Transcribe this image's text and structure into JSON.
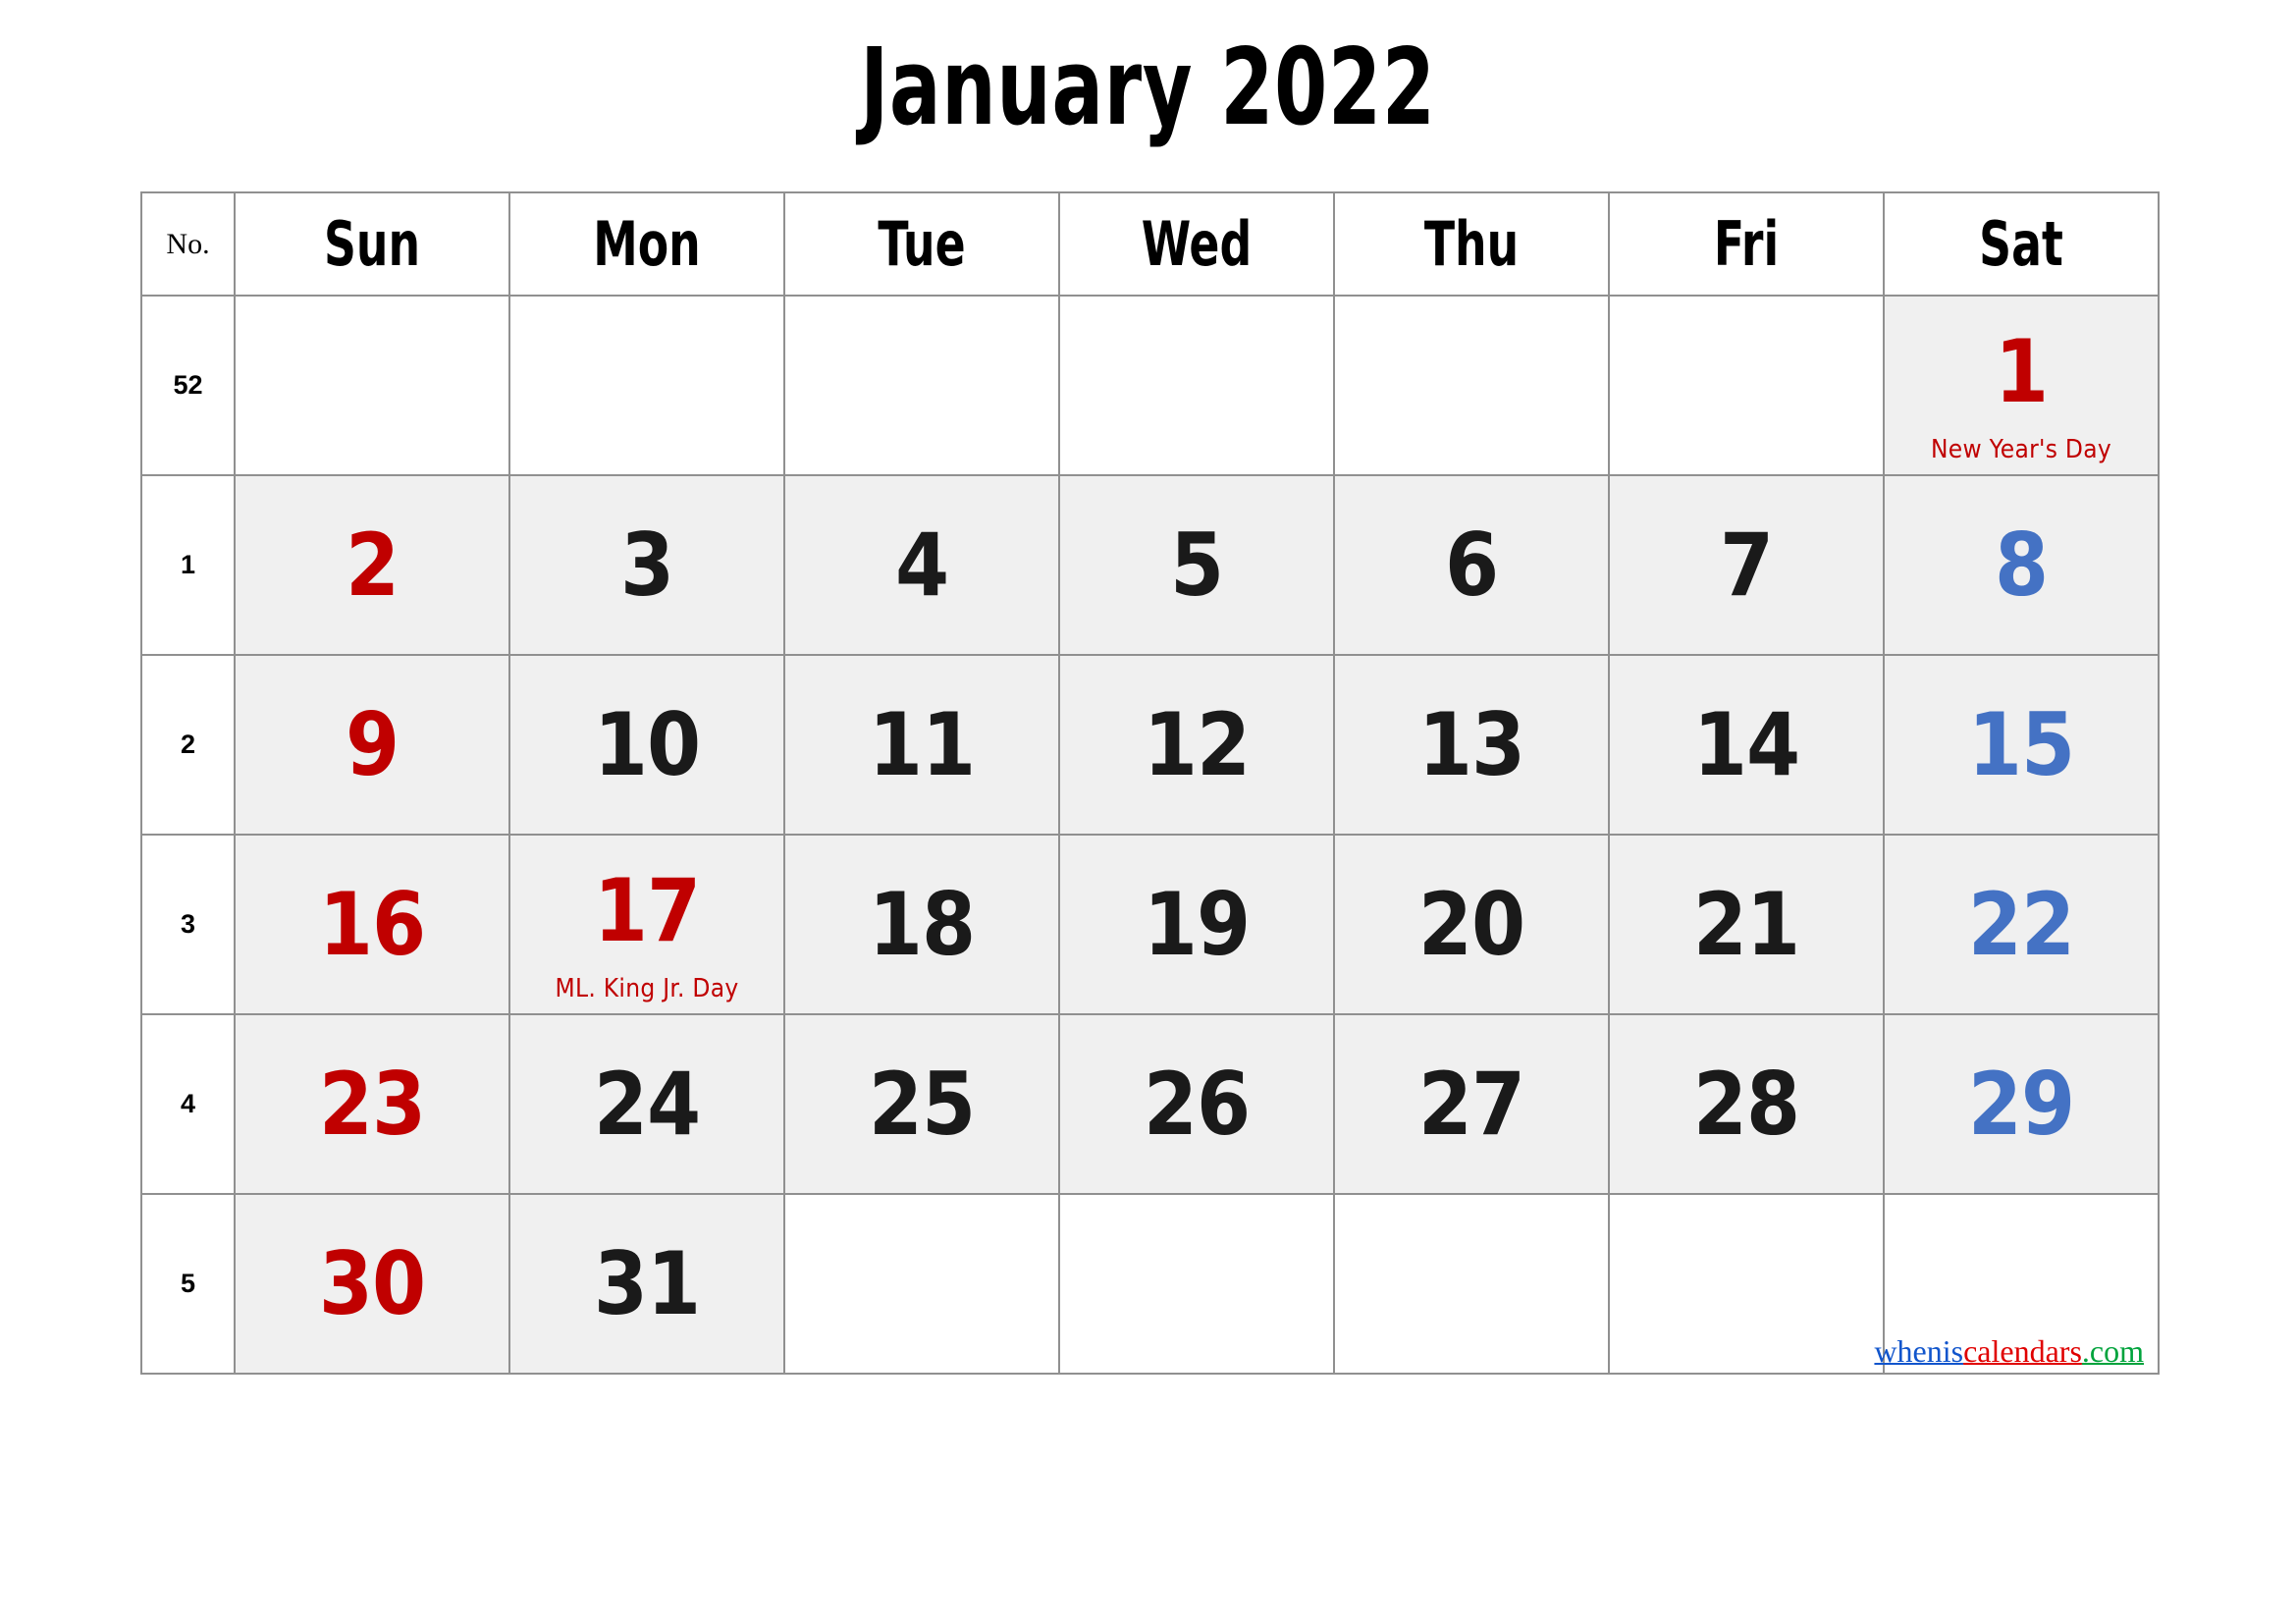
{
  "title": "January 2022",
  "colors": {
    "sunday": "#c00000",
    "saturday": "#4472c4",
    "weekday": "#1a1a1a",
    "holiday": "#c00000",
    "cell_fill": "#f0f0f0",
    "border": "#909090"
  },
  "header": {
    "week_no_label": "No.",
    "days": [
      "Sun",
      "Mon",
      "Tue",
      "Wed",
      "Thu",
      "Fri",
      "Sat"
    ]
  },
  "weeks": [
    {
      "no": "52",
      "days": [
        {
          "num": "",
          "kind": "empty",
          "filled": false,
          "holiday": ""
        },
        {
          "num": "",
          "kind": "empty",
          "filled": false,
          "holiday": ""
        },
        {
          "num": "",
          "kind": "empty",
          "filled": false,
          "holiday": ""
        },
        {
          "num": "",
          "kind": "empty",
          "filled": false,
          "holiday": ""
        },
        {
          "num": "",
          "kind": "empty",
          "filled": false,
          "holiday": ""
        },
        {
          "num": "",
          "kind": "empty",
          "filled": false,
          "holiday": ""
        },
        {
          "num": "1",
          "kind": "holiday",
          "filled": true,
          "holiday": "New Year's Day"
        }
      ]
    },
    {
      "no": "1",
      "days": [
        {
          "num": "2",
          "kind": "sun",
          "filled": true,
          "holiday": ""
        },
        {
          "num": "3",
          "kind": "weekday",
          "filled": true,
          "holiday": ""
        },
        {
          "num": "4",
          "kind": "weekday",
          "filled": true,
          "holiday": ""
        },
        {
          "num": "5",
          "kind": "weekday",
          "filled": true,
          "holiday": ""
        },
        {
          "num": "6",
          "kind": "weekday",
          "filled": true,
          "holiday": ""
        },
        {
          "num": "7",
          "kind": "weekday",
          "filled": true,
          "holiday": ""
        },
        {
          "num": "8",
          "kind": "sat",
          "filled": true,
          "holiday": ""
        }
      ]
    },
    {
      "no": "2",
      "days": [
        {
          "num": "9",
          "kind": "sun",
          "filled": true,
          "holiday": ""
        },
        {
          "num": "10",
          "kind": "weekday",
          "filled": true,
          "holiday": ""
        },
        {
          "num": "11",
          "kind": "weekday",
          "filled": true,
          "holiday": ""
        },
        {
          "num": "12",
          "kind": "weekday",
          "filled": true,
          "holiday": ""
        },
        {
          "num": "13",
          "kind": "weekday",
          "filled": true,
          "holiday": ""
        },
        {
          "num": "14",
          "kind": "weekday",
          "filled": true,
          "holiday": ""
        },
        {
          "num": "15",
          "kind": "sat",
          "filled": true,
          "holiday": ""
        }
      ]
    },
    {
      "no": "3",
      "days": [
        {
          "num": "16",
          "kind": "sun",
          "filled": true,
          "holiday": ""
        },
        {
          "num": "17",
          "kind": "holiday",
          "filled": true,
          "holiday": "ML. King Jr. Day"
        },
        {
          "num": "18",
          "kind": "weekday",
          "filled": true,
          "holiday": ""
        },
        {
          "num": "19",
          "kind": "weekday",
          "filled": true,
          "holiday": ""
        },
        {
          "num": "20",
          "kind": "weekday",
          "filled": true,
          "holiday": ""
        },
        {
          "num": "21",
          "kind": "weekday",
          "filled": true,
          "holiday": ""
        },
        {
          "num": "22",
          "kind": "sat",
          "filled": true,
          "holiday": ""
        }
      ]
    },
    {
      "no": "4",
      "days": [
        {
          "num": "23",
          "kind": "sun",
          "filled": true,
          "holiday": ""
        },
        {
          "num": "24",
          "kind": "weekday",
          "filled": true,
          "holiday": ""
        },
        {
          "num": "25",
          "kind": "weekday",
          "filled": true,
          "holiday": ""
        },
        {
          "num": "26",
          "kind": "weekday",
          "filled": true,
          "holiday": ""
        },
        {
          "num": "27",
          "kind": "weekday",
          "filled": true,
          "holiday": ""
        },
        {
          "num": "28",
          "kind": "weekday",
          "filled": true,
          "holiday": ""
        },
        {
          "num": "29",
          "kind": "sat",
          "filled": true,
          "holiday": ""
        }
      ]
    },
    {
      "no": "5",
      "days": [
        {
          "num": "30",
          "kind": "sun",
          "filled": true,
          "holiday": ""
        },
        {
          "num": "31",
          "kind": "weekday",
          "filled": true,
          "holiday": ""
        },
        {
          "num": "",
          "kind": "empty",
          "filled": false,
          "holiday": ""
        },
        {
          "num": "",
          "kind": "empty",
          "filled": false,
          "holiday": ""
        },
        {
          "num": "",
          "kind": "empty",
          "filled": false,
          "holiday": ""
        },
        {
          "num": "",
          "kind": "empty",
          "filled": false,
          "holiday": ""
        },
        {
          "num": "",
          "kind": "empty",
          "filled": false,
          "holiday": ""
        }
      ]
    }
  ],
  "watermark": {
    "part1": "whenis",
    "part2": "calendars",
    "part3": ".com"
  }
}
